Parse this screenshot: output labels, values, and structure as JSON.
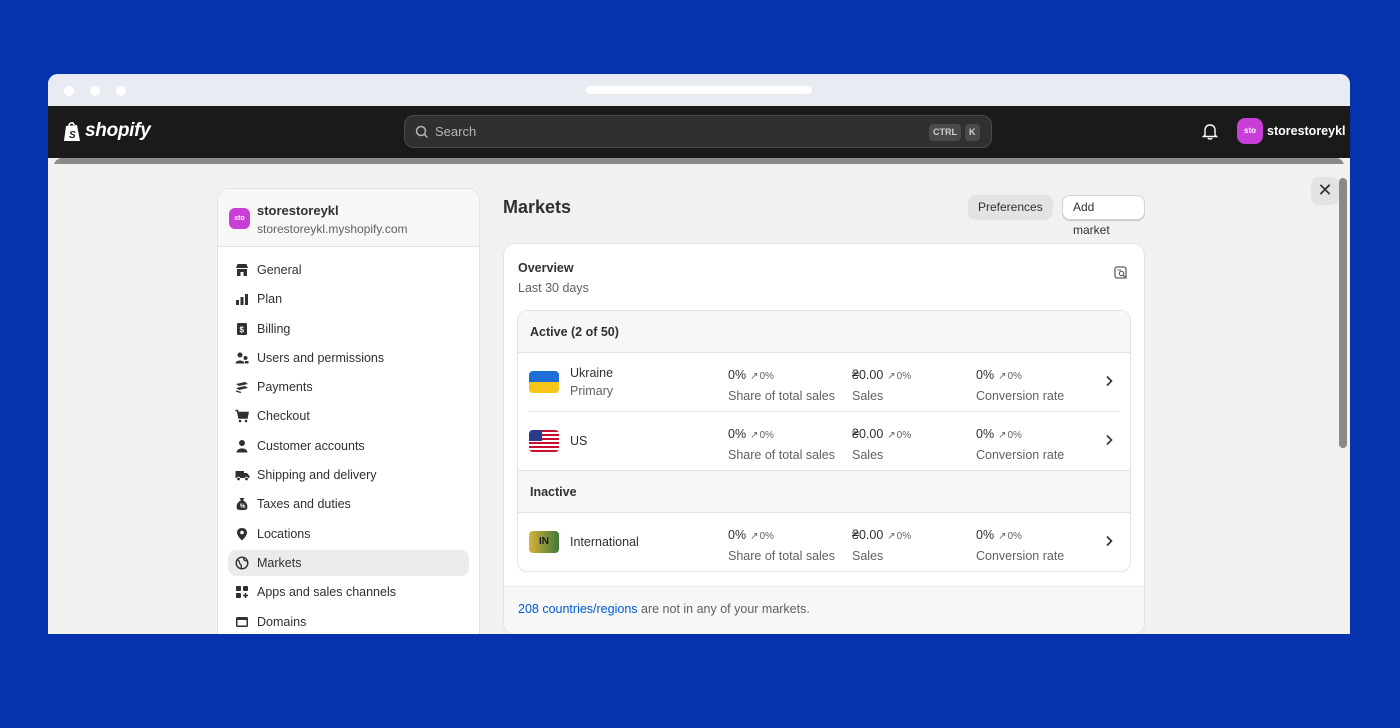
{
  "topbar": {
    "brand": "shopify",
    "search_placeholder": "Search",
    "shortcut_ctrl": "CTRL",
    "shortcut_key": "K",
    "avatar_initials": "sto",
    "store_name": "storestoreykl"
  },
  "sidebar": {
    "store_name": "storestoreykl",
    "store_domain": "storestoreykl.myshopify.com",
    "avatar_initials": "sto",
    "items": [
      {
        "label": "General",
        "icon": "store-icon"
      },
      {
        "label": "Plan",
        "icon": "plan-icon"
      },
      {
        "label": "Billing",
        "icon": "billing-icon"
      },
      {
        "label": "Users and permissions",
        "icon": "users-icon"
      },
      {
        "label": "Payments",
        "icon": "payments-icon"
      },
      {
        "label": "Checkout",
        "icon": "cart-icon"
      },
      {
        "label": "Customer accounts",
        "icon": "person-icon"
      },
      {
        "label": "Shipping and delivery",
        "icon": "truck-icon"
      },
      {
        "label": "Taxes and duties",
        "icon": "tax-icon"
      },
      {
        "label": "Locations",
        "icon": "location-icon"
      },
      {
        "label": "Markets",
        "icon": "globe-icon",
        "active": true
      },
      {
        "label": "Apps and sales channels",
        "icon": "apps-icon"
      },
      {
        "label": "Domains",
        "icon": "domains-icon"
      }
    ]
  },
  "main": {
    "title": "Markets",
    "preferences_label": "Preferences",
    "add_market_label": "Add market",
    "overview": {
      "title": "Overview",
      "subtitle": "Last 30 days"
    },
    "active_header": "Active (2 of 50)",
    "inactive_header": "Inactive",
    "markets": [
      {
        "name": "Ukraine",
        "sub": "Primary",
        "share": "0%",
        "share_chg": "0%",
        "sales": "₴0.00",
        "sales_chg": "0%",
        "conv": "0%",
        "conv_chg": "0%"
      },
      {
        "name": "US",
        "sub": "",
        "share": "0%",
        "share_chg": "0%",
        "sales": "₴0.00",
        "sales_chg": "0%",
        "conv": "0%",
        "conv_chg": "0%"
      },
      {
        "name": "International",
        "sub": "",
        "badge": "IN",
        "share": "0%",
        "share_chg": "0%",
        "sales": "₴0.00",
        "sales_chg": "0%",
        "conv": "0%",
        "conv_chg": "0%"
      }
    ],
    "metric_labels": {
      "share": "Share of total sales",
      "sales": "Sales",
      "conv": "Conversion rate"
    },
    "footer_link": "208 countries/regions",
    "footer_text": " are not in any of your markets."
  },
  "colors": {
    "frame": "#0433ad",
    "topbar": "#1a1a1a",
    "avatar": "#c93ed6",
    "link": "#005bd3"
  }
}
